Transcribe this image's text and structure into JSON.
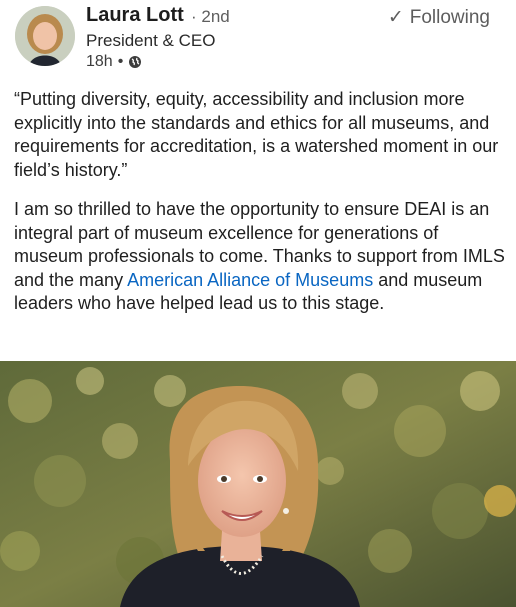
{
  "author": {
    "name": "Laura Lott",
    "degree": "· 2nd",
    "title": "President & CEO",
    "time": "18h",
    "dot": "•",
    "visibility_icon": "globe-icon"
  },
  "follow": {
    "check_icon": "✓",
    "label": "Following"
  },
  "post": {
    "quote": "“Putting diversity, equity, accessibility and inclusion more explicitly into the standards and ethics for all museums, and requirements for accreditation, is a watershed moment in our field’s history.”",
    "para_before_link": "I am so thrilled to have the opportunity to ensure DEAI is an integral part of museum excellence for generations of museum professionals to come. Thanks to support from IMLS and the many ",
    "link_text": "American Alliance of Museums",
    "para_after_link": " and museum leaders who have helped lead us to this stage."
  },
  "colors": {
    "link": "#0a66c2",
    "meta_text": "#5e5e5e"
  }
}
